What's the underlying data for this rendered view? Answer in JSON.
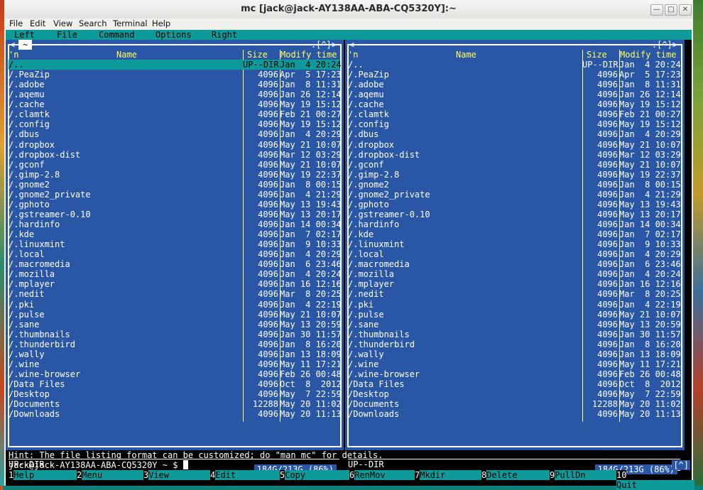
{
  "window": {
    "title": "mc [jack@jack-AY138AA-ABA-CQ5320Y]:~"
  },
  "menubar": [
    "File",
    "Edit",
    "View",
    "Search",
    "Terminal",
    "Help"
  ],
  "mc_menu": [
    "Left",
    "File",
    "Command",
    "Options",
    "Right"
  ],
  "left_panel": {
    "cwd": "~",
    "top_left": "<-",
    "top_right": ".[^]>",
    "header": {
      "n": "'n",
      "name": "Name",
      "size": "Size",
      "mod": "Modify time"
    },
    "status": "UP--DIR",
    "disk": "184G/213G (86%)"
  },
  "right_panel": {
    "cwd": "~",
    "top_left": "<-",
    "top_right": ".[^]>",
    "header": {
      "n": "'n",
      "name": "Name",
      "size": "Size",
      "mod": "Modify time"
    },
    "status": "UP--DIR",
    "disk": "184G/213G (86%)"
  },
  "files": [
    {
      "name": "/..",
      "size": "UP--DIR",
      "mod": "Jan  4 20:24"
    },
    {
      "name": "/.PeaZip",
      "size": "4096",
      "mod": "Apr  5 17:23"
    },
    {
      "name": "/.adobe",
      "size": "4096",
      "mod": "Jan  8 11:31"
    },
    {
      "name": "/.aqemu",
      "size": "4096",
      "mod": "Jan 26 12:14"
    },
    {
      "name": "/.cache",
      "size": "4096",
      "mod": "May 19 15:12"
    },
    {
      "name": "/.clamtk",
      "size": "4096",
      "mod": "Feb 21 00:27"
    },
    {
      "name": "/.config",
      "size": "4096",
      "mod": "May 19 15:12"
    },
    {
      "name": "/.dbus",
      "size": "4096",
      "mod": "Jan  4 20:29"
    },
    {
      "name": "/.dropbox",
      "size": "4096",
      "mod": "May 21 10:07"
    },
    {
      "name": "/.dropbox-dist",
      "size": "4096",
      "mod": "Mar 12 03:29"
    },
    {
      "name": "/.gconf",
      "size": "4096",
      "mod": "May 21 10:07"
    },
    {
      "name": "/.gimp-2.8",
      "size": "4096",
      "mod": "May 19 22:37"
    },
    {
      "name": "/.gnome2",
      "size": "4096",
      "mod": "Jan  8 00:15"
    },
    {
      "name": "/.gnome2_private",
      "size": "4096",
      "mod": "Jan  4 21:29"
    },
    {
      "name": "/.gphoto",
      "size": "4096",
      "mod": "May 13 19:43"
    },
    {
      "name": "/.gstreamer-0.10",
      "size": "4096",
      "mod": "May 13 20:17"
    },
    {
      "name": "/.hardinfo",
      "size": "4096",
      "mod": "Jan 14 00:34"
    },
    {
      "name": "/.kde",
      "size": "4096",
      "mod": "Jan  7 02:17"
    },
    {
      "name": "/.linuxmint",
      "size": "4096",
      "mod": "Jan  9 10:33"
    },
    {
      "name": "/.local",
      "size": "4096",
      "mod": "Jan  4 20:29"
    },
    {
      "name": "/.macromedia",
      "size": "4096",
      "mod": "Jan  6 23:46"
    },
    {
      "name": "/.mozilla",
      "size": "4096",
      "mod": "Jan  4 20:24"
    },
    {
      "name": "/.mplayer",
      "size": "4096",
      "mod": "Jan 16 12:16"
    },
    {
      "name": "/.nedit",
      "size": "4096",
      "mod": "Mar  8 20:25"
    },
    {
      "name": "/.pki",
      "size": "4096",
      "mod": "Jan  4 22:19"
    },
    {
      "name": "/.pulse",
      "size": "4096",
      "mod": "May 21 10:07"
    },
    {
      "name": "/.sane",
      "size": "4096",
      "mod": "May 13 20:59"
    },
    {
      "name": "/.thumbnails",
      "size": "4096",
      "mod": "Jan 30 11:57"
    },
    {
      "name": "/.thunderbird",
      "size": "4096",
      "mod": "Jan  8 16:20"
    },
    {
      "name": "/.wally",
      "size": "4096",
      "mod": "Jan 13 18:09"
    },
    {
      "name": "/.wine",
      "size": "4096",
      "mod": "May 11 17:21"
    },
    {
      "name": "/.wine-browser",
      "size": "4096",
      "mod": "Feb 26 00:48"
    },
    {
      "name": "/Data Files",
      "size": "4096",
      "mod": "Oct  8  2012"
    },
    {
      "name": "/Desktop",
      "size": "4096",
      "mod": "May  7 22:59"
    },
    {
      "name": "/Documents",
      "size": "12288",
      "mod": "May 20 11:02"
    },
    {
      "name": "/Downloads",
      "size": "4096",
      "mod": "May 20 11:13"
    }
  ],
  "hint": "Hint: The file listing format can be customized; do \"man mc\" for details.",
  "prompt": "jack@jack-AY138AA-ABA-CQ5320Y ~ $ ",
  "caret_box": "[^]",
  "fkeys": [
    {
      "num": "1",
      "label": "Help"
    },
    {
      "num": "2",
      "label": "Menu"
    },
    {
      "num": "3",
      "label": "View"
    },
    {
      "num": "4",
      "label": "Edit"
    },
    {
      "num": "5",
      "label": "Copy"
    },
    {
      "num": "6",
      "label": "RenMov"
    },
    {
      "num": "7",
      "label": "Mkdir"
    },
    {
      "num": "8",
      "label": "Delete"
    },
    {
      "num": "9",
      "label": "PullDn"
    },
    {
      "num": "10",
      "label": "Quit"
    }
  ]
}
